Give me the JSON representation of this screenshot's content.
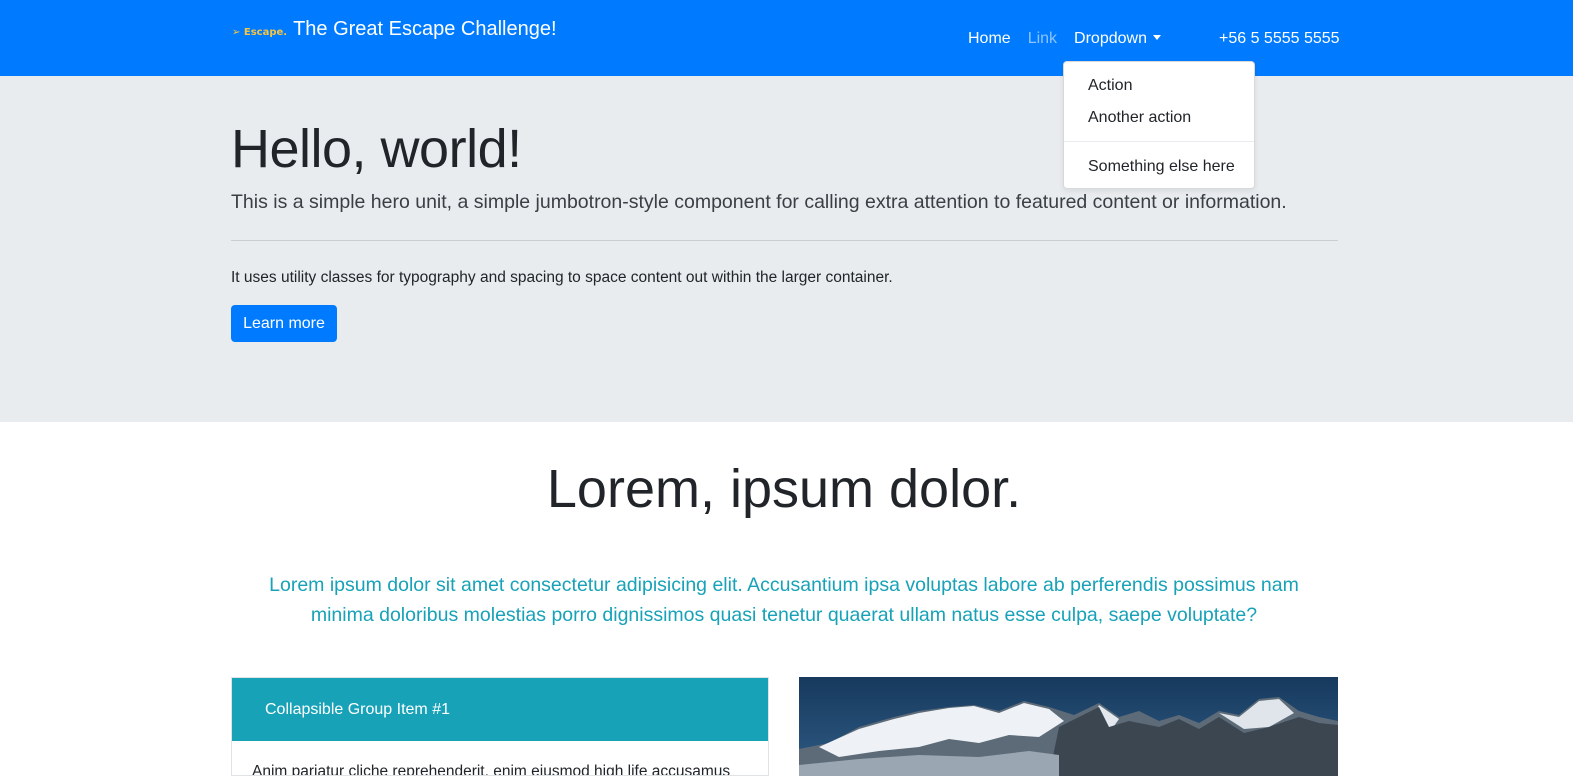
{
  "navbar": {
    "logo_text": "➢ Escape.",
    "brand_title": "The Great Escape Challenge!",
    "links": [
      "Home",
      "Link",
      "Dropdown"
    ],
    "phone": "+56 5 5555 5555",
    "background": "#007bff"
  },
  "dropdown": {
    "items": [
      "Action",
      "Another action",
      "Something else here"
    ]
  },
  "hero": {
    "title": "Hello, world!",
    "lead": "This is a simple hero unit, a simple jumbotron-style component for calling extra attention to featured content or information.",
    "text": "It uses utility classes for typography and spacing to space content out within the larger container.",
    "button_label": "Learn more",
    "background": "#e9ecef"
  },
  "section": {
    "title": "Lorem, ipsum dolor.",
    "lead": "Lorem ipsum dolor sit amet consectetur adipisicing elit. Accusantium ipsa voluptas labore ab perferendis possimus nam minima doloribus molestias porro dignissimos quasi tenetur quaerat ullam natus esse culpa, saepe voluptate?",
    "lead_color": "#17a2b8"
  },
  "accordion": {
    "header": "Collapsible Group Item #1",
    "body": "Anim pariatur cliche reprehenderit, enim eiusmod high life accusamus",
    "header_color": "#17a2b8"
  },
  "image": {
    "icon": "mountain-photo"
  }
}
